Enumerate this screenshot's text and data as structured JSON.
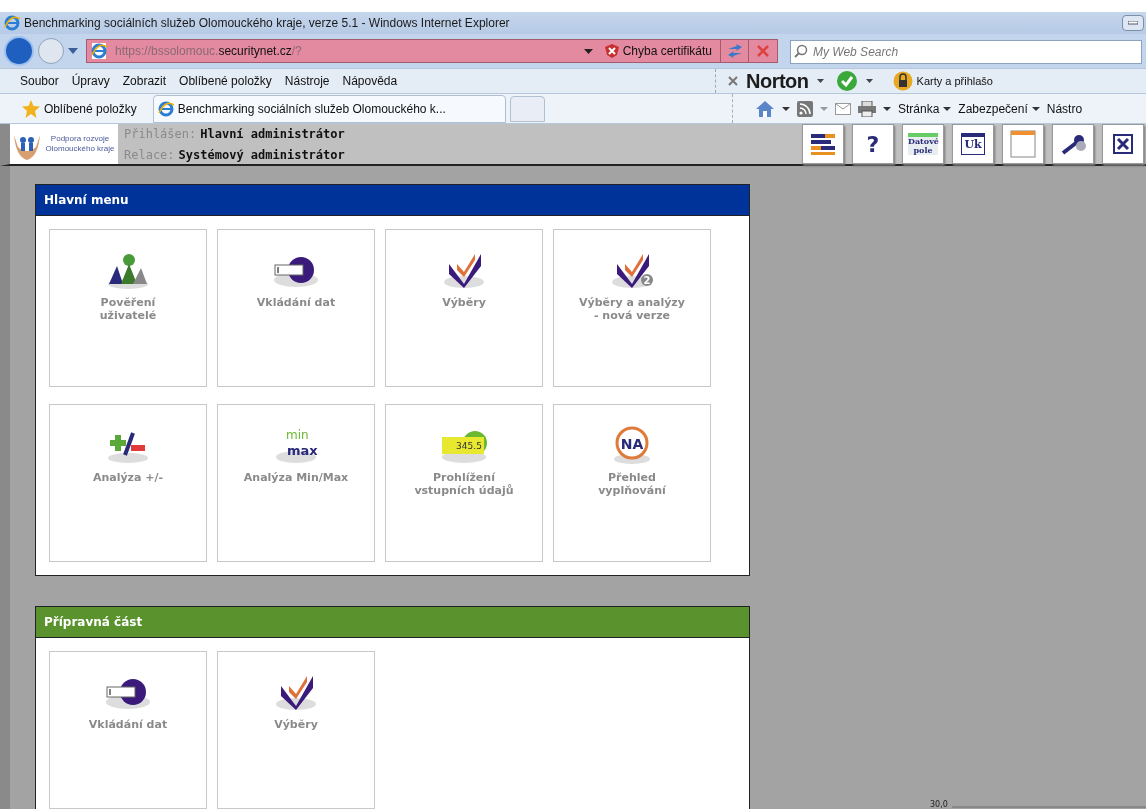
{
  "window": {
    "title": "Benchmarking sociálních služeb Olomouckého kraje, verze 5.1 - Windows Internet Explorer"
  },
  "address_bar": {
    "url_parts": [
      {
        "text": "https://bssolomouc.",
        "emphasis": false
      },
      {
        "text": "securitynet.cz",
        "emphasis": true
      },
      {
        "text": "/?",
        "emphasis": false
      }
    ],
    "certificate_error": "Chyba certifikátu"
  },
  "search": {
    "placeholder": "My Web Search"
  },
  "menu_bar": [
    "Soubor",
    "Úpravy",
    "Zobrazit",
    "Oblíbené položky",
    "Nástroje",
    "Nápověda"
  ],
  "norton_bar": {
    "brand": "Norton",
    "cards_label": "Karty a přihlašo"
  },
  "favorites_bar": {
    "favorites": "Oblíbené položky",
    "tab": "Benchmarking sociálních služeb Olomouckého k...",
    "commands": [
      "Stránka",
      "Zabezpečení",
      "Nástro"
    ]
  },
  "header": {
    "logo_text": "Podpora rozvoje Olomouckého kraje",
    "fields": [
      {
        "label": "Přihlášen:",
        "value": "Hlavní administrátor"
      },
      {
        "label": "Relace:",
        "value": "Systémový administrátor"
      }
    ],
    "tools": [
      {
        "kind": "list"
      },
      {
        "kind": "help",
        "text": "?"
      },
      {
        "kind": "fields",
        "text": "Datové pole"
      },
      {
        "kind": "uk",
        "text": "Uk"
      },
      {
        "kind": "blank"
      },
      {
        "kind": "keys"
      },
      {
        "kind": "close"
      }
    ]
  },
  "panels": [
    {
      "title": "Hlavní menu",
      "color": "#003399",
      "tiles": [
        {
          "lines": [
            "Pověření",
            "uživatelé"
          ],
          "kind": "people"
        },
        {
          "lines": [
            "Vkládání dat"
          ],
          "kind": "input"
        },
        {
          "lines": [
            "Výběry"
          ],
          "kind": "check"
        },
        {
          "lines": [
            "Výběry a analýzy",
            "- nová verze"
          ],
          "kind": "check2",
          "icon_text": "2"
        },
        {
          "lines": [
            "Analýza +/-"
          ],
          "kind": "plusminus"
        },
        {
          "lines": [
            "Analýza Min/Max"
          ],
          "kind": "minmax",
          "icon_text": "min max"
        },
        {
          "lines": [
            "Prohlížení",
            "vstupních údajů"
          ],
          "kind": "display",
          "icon_text": "345.5"
        },
        {
          "lines": [
            "Přehled",
            "vyplňování"
          ],
          "kind": "na",
          "icon_text": "NA"
        }
      ]
    },
    {
      "title": "Přípravná část",
      "color": "#5a922e",
      "tiles": [
        {
          "lines": [
            "Vkládání dat"
          ],
          "kind": "input"
        },
        {
          "lines": [
            "Výběry"
          ],
          "kind": "check"
        }
      ]
    }
  ],
  "chart_fragment": {
    "label": "30,0"
  }
}
